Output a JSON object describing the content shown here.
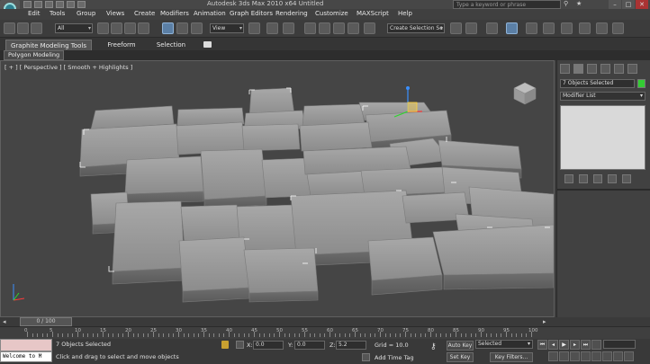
{
  "window": {
    "title": "Autodesk 3ds Max  2010 x64      Untitled",
    "search_placeholder": "Type a keyword or phrase",
    "minimize": "–",
    "maximize": "□",
    "close": "✕"
  },
  "menus": [
    "Edit",
    "Tools",
    "Group",
    "Views",
    "Create",
    "Modifiers",
    "Animation",
    "Graph Editors",
    "Rendering",
    "Customize",
    "MAXScript",
    "Help"
  ],
  "toolbar": {
    "selection_filter": "All",
    "reference_coord": "View",
    "named_selection": "Create Selection Se"
  },
  "ribbon": {
    "tabs": [
      "Graphite Modeling Tools",
      "Freeform",
      "Selection"
    ],
    "active_tab": "Graphite Modeling Tools",
    "subtab": "Polygon Modeling"
  },
  "viewport": {
    "label": "[ + ] [ Perspective ] [ Smooth + Highlights ]",
    "background": "#454545",
    "tile_color": "#9a9a9a"
  },
  "command_panel": {
    "objects_selected": "7 Objects Selected",
    "modifier_list": "Modifier List",
    "object_color": "#33cc33"
  },
  "timeline": {
    "slider_label": "0 / 100",
    "ticks": [
      "0",
      "5",
      "10",
      "15",
      "20",
      "25",
      "30",
      "35",
      "40",
      "45",
      "50",
      "55",
      "60",
      "65",
      "70",
      "75",
      "80",
      "85",
      "90",
      "95",
      "100"
    ]
  },
  "status": {
    "selected": "7 Objects Selected",
    "prompt": "Click and drag to select and move objects",
    "welcome": "Welcome to M",
    "x_label": "X:",
    "x_value": "0.0",
    "y_label": "Y:",
    "y_value": "0.0",
    "z_label": "Z:",
    "z_value": "5.2",
    "grid": "Grid = 10.0",
    "add_time_tag": "Add Time Tag",
    "auto_key": "Auto Key",
    "set_key": "Set Key",
    "key_mode": "Selected",
    "key_filters": "Key Filters..."
  }
}
